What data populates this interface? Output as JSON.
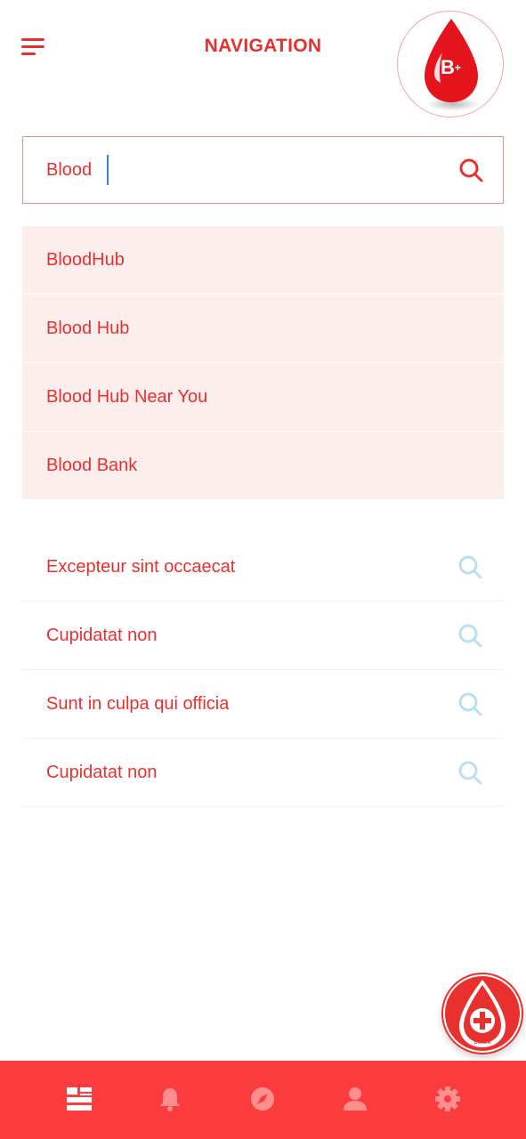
{
  "header": {
    "title": "NAVIGATION",
    "menu_icon": "hamburger-menu-icon",
    "badge": {
      "icon": "blood-drop-icon",
      "blood_type": "B",
      "sign": "+"
    }
  },
  "search": {
    "value": "Blood",
    "placeholder": "",
    "icon": "search-icon"
  },
  "suggestions": [
    {
      "label": "BloodHub"
    },
    {
      "label": "Blood Hub"
    },
    {
      "label": "Blood Hub Near You"
    },
    {
      "label": "Blood Bank"
    }
  ],
  "recent_searches": [
    {
      "label": "Excepteur sint occaecat",
      "icon": "search-icon"
    },
    {
      "label": "Cupidatat non",
      "icon": "search-icon"
    },
    {
      "label": "Sunt in culpa qui officia",
      "icon": "search-icon"
    },
    {
      "label": "Cupidatat non",
      "icon": "search-icon"
    }
  ],
  "fab": {
    "icon": "blood-drop-plus-icon",
    "label": "BECOME A DONOR"
  },
  "bottom_nav": {
    "items": [
      {
        "icon": "dashboard-icon",
        "active": true
      },
      {
        "icon": "bell-icon",
        "active": false
      },
      {
        "icon": "compass-icon",
        "active": false
      },
      {
        "icon": "user-icon",
        "active": false
      },
      {
        "icon": "gear-icon",
        "active": false
      }
    ]
  },
  "colors": {
    "primary": "#e8302f",
    "nav_background": "#fb3c3f",
    "suggestion_background": "#fdeeee",
    "recent_icon": "#b9def5",
    "nav_inactive_icon": "#ff8f8f",
    "nav_active_icon": "#ffffff"
  }
}
